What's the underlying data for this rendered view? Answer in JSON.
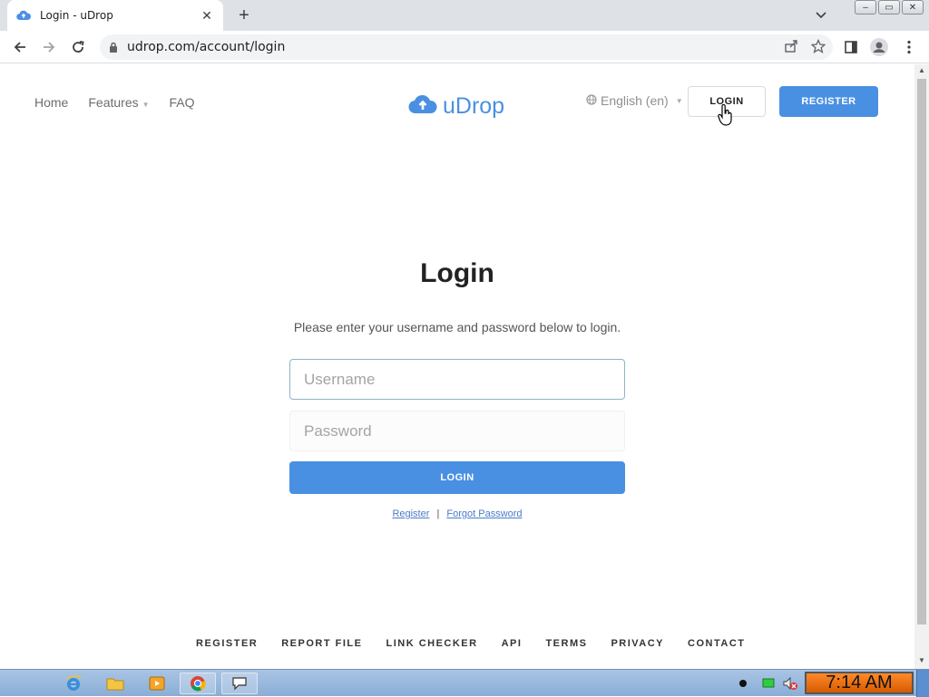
{
  "browser": {
    "tab_title": "Login - uDrop",
    "tab_close": "✕",
    "new_tab": "+",
    "url": "udrop.com/account/login",
    "window_controls": [
      "–",
      "▭",
      "✕"
    ]
  },
  "header": {
    "nav": [
      {
        "label": "Home"
      },
      {
        "label": "Features",
        "has_dropdown": true
      },
      {
        "label": "FAQ"
      }
    ],
    "logo_text": "uDrop",
    "language": "English (en)",
    "login_label": "LOGIN",
    "register_label": "REGISTER",
    "accent_color": "#4a90e2"
  },
  "form": {
    "title": "Login",
    "description": "Please enter your username and password below to login.",
    "username_placeholder": "Username",
    "password_placeholder": "Password",
    "submit_label": "LOGIN",
    "link_register": "Register",
    "link_separator": "|",
    "link_forgot": "Forgot Password"
  },
  "footer": {
    "links": [
      "REGISTER",
      "REPORT FILE",
      "LINK CHECKER",
      "API",
      "TERMS",
      "PRIVACY",
      "CONTACT"
    ]
  },
  "taskbar": {
    "clock": "7:14 AM"
  }
}
